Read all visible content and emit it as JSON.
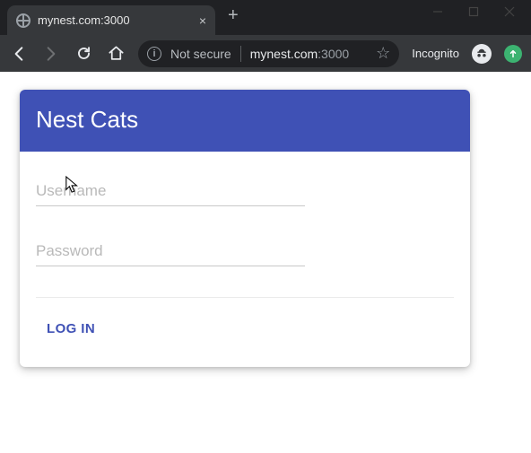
{
  "window": {
    "tab_title": "mynest.com:3000",
    "new_tab_symbol": "+",
    "close_symbol": "×"
  },
  "toolbar": {
    "not_secure_label": "Not secure",
    "url_host": "mynest.com",
    "url_port": ":3000",
    "incognito_label": "Incognito",
    "star_symbol": "☆"
  },
  "card": {
    "title": "Nest Cats"
  },
  "form": {
    "username_placeholder": "Username",
    "password_placeholder": "Password",
    "login_label": "LOG IN"
  }
}
